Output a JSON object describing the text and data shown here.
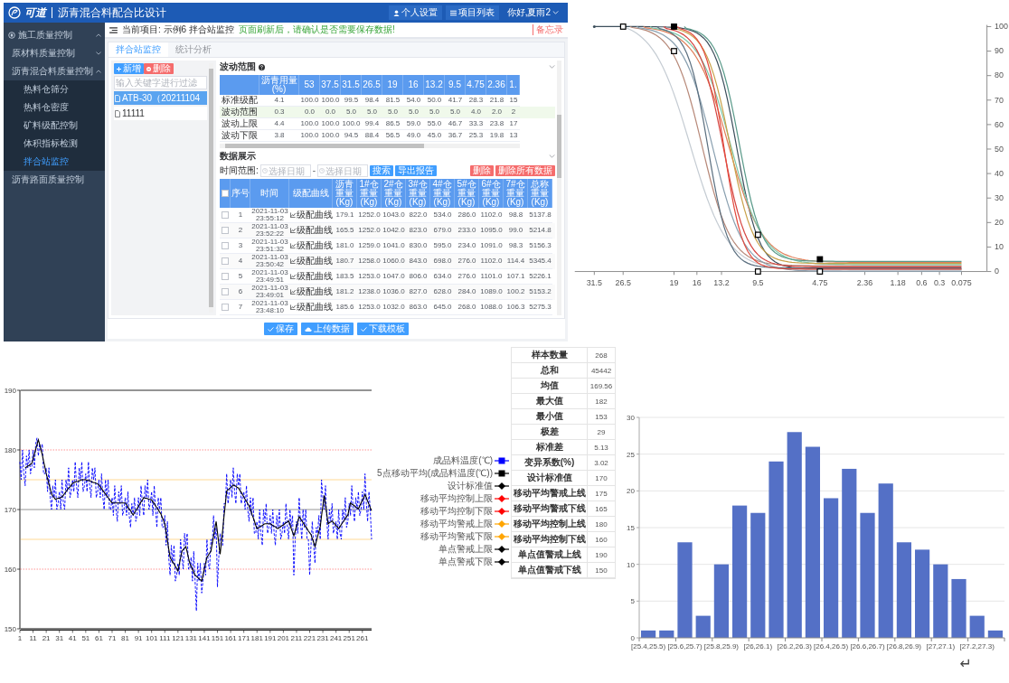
{
  "app": {
    "header": {
      "logo": "可道",
      "title": "沥青混合料配合比设计",
      "links": [
        {
          "label": "个人设置",
          "kind": "user"
        },
        {
          "label": "项目列表",
          "kind": "list"
        }
      ],
      "user_menu": "你好,夏雨2"
    },
    "sidebar": {
      "items": [
        {
          "label": "施工质量控制",
          "expanded": true,
          "children": [
            {
              "label": "原材料质量控制",
              "expanded": false
            },
            {
              "label": "沥青混合料质量控制",
              "expanded": true,
              "children": [
                {
                  "label": "热料仓筛分",
                  "selected": false
                },
                {
                  "label": "热料仓密度",
                  "selected": false
                },
                {
                  "label": "矿料级配控制",
                  "selected": false
                },
                {
                  "label": "体积指标检测",
                  "selected": false
                },
                {
                  "label": "拌合站监控",
                  "selected": true
                }
              ]
            },
            {
              "label": "沥青路面质量控制",
              "selected": false
            }
          ]
        }
      ]
    },
    "toolbar": {
      "breadcrumb": "当前项目: 示例6 拌合站监控",
      "notice": "页面刷新后，请确认是否需要保存数据!",
      "memo": "备忘录"
    },
    "tabs": [
      {
        "label": "拌合站监控",
        "selected": true
      },
      {
        "label": "统计分析",
        "selected": false
      }
    ],
    "record_list": {
      "buttons": [
        {
          "label": "新增",
          "kind": "add"
        },
        {
          "label": "删除",
          "kind": "delete"
        }
      ],
      "filter": {
        "placeholder": "输入关键字进行过滤"
      },
      "items": [
        {
          "label": "ATB-30（20211104",
          "selected": true
        },
        {
          "label": "11111",
          "selected": false
        }
      ]
    },
    "range_section": {
      "title": "波动范围",
      "columns": [
        "沥青用量(%)",
        "53",
        "37.5",
        "31.5",
        "26.5",
        "19",
        "16",
        "13.2",
        "9.5",
        "4.75",
        "2.36",
        "1."
      ],
      "rows": [
        {
          "label": "标准级配",
          "highlighted": false,
          "cells": [
            "4.1",
            "100.0",
            "100.0",
            "99.5",
            "98.4",
            "81.5",
            "54.0",
            "50.0",
            "41.7",
            "28.3",
            "21.8",
            "15"
          ]
        },
        {
          "label": "波动范围",
          "highlighted": true,
          "cells": [
            "0.3",
            "0.0",
            "0.0",
            "5.0",
            "5.0",
            "5.0",
            "5.0",
            "5.0",
            "5.0",
            "4.0",
            "2.0",
            "2"
          ]
        },
        {
          "label": "波动上限",
          "highlighted": false,
          "cells": [
            "4.4",
            "100.0",
            "100.0",
            "100.0",
            "99.4",
            "86.5",
            "59.0",
            "55.0",
            "46.7",
            "33.3",
            "23.8",
            "17"
          ]
        },
        {
          "label": "波动下限",
          "highlighted": false,
          "cells": [
            "3.8",
            "100.0",
            "100.0",
            "94.5",
            "88.4",
            "56.5",
            "49.0",
            "45.0",
            "36.7",
            "25.3",
            "19.8",
            "13"
          ]
        }
      ]
    },
    "data_section": {
      "title": "数据展示",
      "time_label": "时间范围:",
      "date_fields": [
        {
          "placeholder": "选择日期"
        },
        {
          "placeholder": "选择日期"
        }
      ],
      "separator": "-",
      "buttons": [
        {
          "label": "搜索",
          "kind": "search"
        },
        {
          "label": "导出报告",
          "kind": "export"
        },
        {
          "label": "删除",
          "kind": "delete"
        },
        {
          "label": "删除所有数据",
          "kind": "delete_all"
        }
      ],
      "table": {
        "header_checked": false,
        "columns": [
          "序号",
          "时间",
          "级配曲线",
          "沥青重量(Kg)",
          "1#仓重量(Kg)",
          "2#仓重量(Kg)",
          "3#仓重量(Kg)",
          "4#仓重量(Kg)",
          "5#仓重量(Kg)",
          "6#仓重量(Kg)",
          "7#仓重量(Kg)",
          "总称重量(Kg)"
        ],
        "rows": [
          {
            "checked": false,
            "index": "1",
            "time": "2021-11-03 23:55:12",
            "curve": "级配曲线",
            "weights": [
              "179.1",
              "1252.0",
              "1043.0",
              "822.0",
              "534.0",
              "286.0",
              "1102.0",
              "98.8",
              "5137.8"
            ]
          },
          {
            "checked": false,
            "index": "2",
            "time": "2021-11-03 23:52:22",
            "curve": "级配曲线",
            "weights": [
              "165.5",
              "1252.0",
              "1042.0",
              "823.0",
              "679.0",
              "233.0",
              "1095.0",
              "99.0",
              "5214.8"
            ]
          },
          {
            "checked": false,
            "index": "3",
            "time": "2021-11-03 23:51:32",
            "curve": "级配曲线",
            "weights": [
              "181.0",
              "1259.0",
              "1041.0",
              "830.0",
              "595.0",
              "234.0",
              "1091.0",
              "98.3",
              "5156.3"
            ]
          },
          {
            "checked": false,
            "index": "4",
            "time": "2021-11-03 23:50:42",
            "curve": "级配曲线",
            "weights": [
              "180.7",
              "1258.0",
              "1060.0",
              "843.0",
              "698.0",
              "276.0",
              "1102.0",
              "114.4",
              "5345.4"
            ]
          },
          {
            "checked": false,
            "index": "5",
            "time": "2021-11-03 23:49:51",
            "curve": "级配曲线",
            "weights": [
              "183.5",
              "1253.0",
              "1047.0",
              "806.0",
              "634.0",
              "276.0",
              "1101.0",
              "107.1",
              "5226.1"
            ]
          },
          {
            "checked": false,
            "index": "6",
            "time": "2021-11-03 23:49:01",
            "curve": "级配曲线",
            "weights": [
              "181.2",
              "1238.0",
              "1036.0",
              "827.0",
              "628.0",
              "284.0",
              "1089.0",
              "100.2",
              "5153.2"
            ]
          },
          {
            "checked": false,
            "index": "7",
            "time": "2021-11-03 23:48:10",
            "curve": "级配曲线",
            "weights": [
              "185.6",
              "1253.0",
              "1032.0",
              "863.0",
              "645.0",
              "268.0",
              "1088.0",
              "106.3",
              "5275.3"
            ]
          }
        ]
      }
    },
    "footer_buttons": [
      {
        "label": "保存",
        "kind": "save"
      },
      {
        "label": "上传数据",
        "kind": "upload"
      },
      {
        "label": "下载模板",
        "kind": "download"
      }
    ]
  },
  "grading_chart": {
    "x_labels": [
      "31.5",
      "26.5",
      "19",
      "16",
      "13.2",
      "9.5",
      "4.75",
      "2.36",
      "1.18",
      "0.6",
      "0.3",
      "0.075"
    ],
    "y_labels": [
      "100",
      "90",
      "80",
      "70",
      "60",
      "50",
      "40",
      "30",
      "20",
      "10",
      "0"
    ]
  },
  "control_chart": {
    "chart_data": {
      "type": "line",
      "xlim": [
        1,
        268
      ],
      "ylim": [
        150,
        190
      ],
      "xticks": [
        1,
        11,
        21,
        31,
        41,
        51,
        61,
        71,
        81,
        91,
        101,
        111,
        121,
        131,
        141,
        151,
        161,
        171,
        181,
        191,
        201,
        211,
        221,
        231,
        241,
        251,
        261
      ],
      "yticks": [
        150,
        160,
        170,
        180,
        190
      ],
      "x": [
        1,
        2,
        3,
        4,
        5,
        6,
        7,
        8,
        9,
        10,
        11,
        12,
        13,
        14,
        15,
        16,
        17,
        18,
        19,
        20,
        21,
        22,
        23,
        24,
        25,
        26,
        27,
        28,
        29,
        30,
        31,
        32,
        33,
        34,
        35,
        36,
        37,
        38,
        39,
        40,
        41,
        42,
        43,
        44,
        45,
        46,
        47,
        48,
        49,
        50,
        51,
        52,
        53,
        54,
        55,
        56,
        57,
        58,
        59,
        60,
        61,
        62,
        63,
        64,
        65,
        66,
        67,
        68,
        69,
        70,
        71,
        72,
        73,
        74,
        75,
        76,
        77,
        78,
        79,
        80,
        81,
        82,
        83,
        84,
        85,
        86,
        87,
        88,
        89,
        90,
        91,
        92,
        93,
        94,
        95,
        96,
        97,
        98,
        99,
        100,
        101,
        102,
        103,
        104,
        105,
        106,
        107,
        108,
        109,
        110,
        111,
        112,
        113,
        114,
        115,
        116,
        117,
        118,
        119,
        120,
        121,
        122,
        123,
        124,
        125,
        126,
        127,
        128,
        129,
        130,
        131,
        132,
        133,
        134,
        135,
        136,
        137,
        138,
        139,
        140,
        141,
        142,
        143,
        144,
        145,
        146,
        147,
        148,
        149,
        150,
        151,
        152,
        153,
        154,
        155,
        156,
        157,
        158,
        159,
        160,
        161,
        162,
        163,
        164,
        165,
        166,
        167,
        168,
        169,
        170,
        171,
        172,
        173,
        174,
        175,
        176,
        177,
        178,
        179,
        180,
        181,
        182,
        183,
        184,
        185,
        186,
        187,
        188,
        189,
        190,
        191,
        192,
        193,
        194,
        195,
        196,
        197,
        198,
        199,
        200,
        201,
        202,
        203,
        204,
        205,
        206,
        207,
        208,
        209,
        210,
        211,
        212,
        213,
        214,
        215,
        216,
        217,
        218,
        219,
        220,
        221,
        222,
        223,
        224,
        225,
        226,
        227,
        228,
        229,
        230,
        231,
        232,
        233,
        234,
        235,
        236,
        237,
        238,
        239,
        240,
        241,
        242,
        243,
        244,
        245,
        246,
        247,
        248,
        249,
        250,
        251,
        252,
        253,
        254,
        255,
        256,
        257,
        258,
        259,
        260,
        261,
        262,
        263,
        264,
        265,
        266,
        267,
        268
      ],
      "series": [
        {
          "name": "成品料温度(℃)",
          "color": "#0000ff",
          "line_style": "dashed",
          "values": [
            178,
            175,
            180,
            176,
            174,
            179,
            177,
            180,
            176,
            177,
            180,
            177,
            181,
            182,
            179,
            181,
            180,
            181,
            176,
            176,
            177,
            173,
            177,
            172,
            170,
            174,
            172,
            175,
            170,
            171,
            173,
            170,
            175,
            171,
            170,
            175,
            173,
            177,
            172,
            173,
            175,
            173,
            178,
            174,
            172,
            177,
            175,
            178,
            173,
            174,
            176,
            173,
            178,
            174,
            172,
            177,
            175,
            177,
            172,
            173,
            175,
            172,
            176,
            172,
            170,
            175,
            172,
            175,
            170,
            170,
            172,
            169,
            174,
            170,
            168,
            173,
            171,
            174,
            169,
            170,
            172,
            169,
            173,
            169,
            167,
            171,
            169,
            172,
            168,
            169,
            172,
            169,
            174,
            171,
            169,
            174,
            172,
            175,
            170,
            171,
            173,
            169,
            174,
            170,
            167,
            172,
            170,
            172,
            167,
            167,
            169,
            164,
            168,
            162,
            159,
            164,
            161,
            164,
            158,
            159,
            161,
            159,
            165,
            162,
            160,
            166,
            164,
            166,
            160,
            160,
            162,
            158,
            163,
            158,
            153,
            161,
            158,
            161,
            156,
            158,
            161,
            159,
            165,
            161,
            160,
            165,
            164,
            169,
            165,
            167,
            157,
            162,
            166,
            164,
            164,
            171,
            171,
            176,
            171,
            173,
            175,
            172,
            177,
            173,
            171,
            176,
            174,
            176,
            171,
            172,
            173,
            170,
            174,
            170,
            168,
            172,
            169,
            172,
            166,
            166,
            168,
            165,
            170,
            166,
            164,
            170,
            168,
            171,
            166,
            167,
            169,
            166,
            170,
            166,
            164,
            169,
            167,
            170,
            165,
            166,
            168,
            166,
            171,
            167,
            165,
            170,
            167,
            169,
            159,
            165,
            168,
            166,
            172,
            168,
            165,
            170,
            167,
            170,
            165,
            165,
            159,
            164,
            168,
            164,
            161,
            167,
            166,
            169,
            165,
            175,
            172,
            170,
            174,
            168,
            165,
            170,
            168,
            171,
            166,
            167,
            168,
            165,
            170,
            166,
            165,
            170,
            168,
            172,
            167,
            168,
            171,
            169,
            174,
            170,
            168,
            172,
            170,
            173,
            169,
            170,
            173,
            170,
            176,
            171,
            168,
            173,
            170,
            165
          ]
        },
        {
          "name": "5点移动平均(成品料温度(℃))",
          "color": "#000000",
          "values": [
            null,
            null,
            null,
            null,
            177,
            177.1,
            177.3,
            177.4,
            177.6,
            177.7,
            178.5,
            179.3,
            180.1,
            180.9,
            181.7,
            180.9,
            180,
            179.2,
            178.1,
            177.1,
            176,
            175.2,
            174.3,
            173.5,
            172.6,
            172.3,
            172,
            171.7,
            171.8,
            171.9,
            171.9,
            172,
            172.1,
            172.4,
            172.7,
            173,
            173.3,
            173.6,
            173.8,
            174.1,
            174.4,
            174.5,
            174.6,
            174.7,
            174.7,
            174.8,
            174.9,
            175,
            175,
            175,
            175,
            174.9,
            174.9,
            174.8,
            174.7,
            174.6,
            174.5,
            174.5,
            174.4,
            174.3,
            174.1,
            173.8,
            173.5,
            173.2,
            172.9,
            172.6,
            172.3,
            172,
            171.7,
            171.4,
            171.1,
            171.1,
            171.1,
            171.1,
            171.1,
            171.1,
            171.1,
            171.1,
            171.1,
            171.1,
            171.1,
            170.8,
            170.4,
            170.1,
            169.8,
            169.4,
            169.1,
            169.5,
            169.8,
            170.2,
            170.5,
            170.9,
            171.3,
            171.6,
            172,
            171.9,
            171.9,
            171.8,
            171.7,
            171.7,
            171.6,
            171.3,
            171,
            170.6,
            170.3,
            170,
            169.6,
            169.3,
            168.7,
            168.2,
            167.6,
            166.2,
            164.8,
            163.4,
            162,
            161.6,
            161.2,
            160.9,
            160.5,
            160.1,
            159.7,
            160.8,
            161.9,
            163,
            163.3,
            163.5,
            163.8,
            162.9,
            161.9,
            161,
            160.5,
            160,
            159.5,
            159,
            158.8,
            158.6,
            158.4,
            158.2,
            158,
            159,
            160,
            161,
            162,
            162.3,
            162.7,
            163,
            164.3,
            165.5,
            166.8,
            168,
            166.2,
            164.3,
            162.5,
            164.6,
            166.7,
            168.9,
            171,
            173.1,
            173.3,
            173.5,
            173.7,
            173.9,
            174.1,
            174,
            173.9,
            173.7,
            173.6,
            173.2,
            172.9,
            172.5,
            172.1,
            171.7,
            171.4,
            171,
            170.6,
            170,
            169.3,
            168.7,
            168.1,
            167.4,
            166.8,
            166.9,
            167.1,
            167.2,
            167.3,
            167.5,
            167.6,
            167.6,
            167.6,
            167.6,
            167.6,
            167.5,
            167.3,
            167.2,
            167.1,
            166.9,
            166.8,
            167,
            167.1,
            167.3,
            167.4,
            167.6,
            167.8,
            167.9,
            168.1,
            167.5,
            166.8,
            166.2,
            165.6,
            166.4,
            167.2,
            168,
            168.8,
            168.5,
            168.1,
            167.8,
            167.4,
            167.1,
            166.8,
            166.4,
            166.1,
            165.8,
            165.1,
            164.5,
            163.8,
            164.6,
            165.5,
            166.3,
            167.1,
            168.9,
            170.6,
            172.4,
            170.8,
            169.2,
            167.6,
            167.8,
            167.9,
            168.1,
            167.8,
            167.6,
            167.3,
            167.1,
            166.8,
            167.1,
            167.5,
            167.8,
            168.1,
            168.5,
            168.8,
            169.1,
            170.1,
            171.1,
            170.9,
            170.8,
            170.6,
            170.4,
            170.3,
            170.1,
            170.6,
            171.1,
            171.5,
            172,
            172.5,
            172,
            171.4,
            170.9,
            170.3,
            169.8
          ]
        }
      ],
      "ref_lines": [
        {
          "axis": "y",
          "value": 170,
          "label": "设计标准值",
          "color": "#000000"
        },
        {
          "axis": "y",
          "value": 180,
          "label": "移动平均控制上限",
          "color": "#ff0000",
          "line_style": "dotted"
        },
        {
          "axis": "y",
          "value": 160,
          "label": "移动平均控制下限",
          "color": "#ff0000",
          "line_style": "dotted"
        },
        {
          "axis": "y",
          "value": 175,
          "label": "移动平均警戒上限",
          "color": "#ffa500"
        },
        {
          "axis": "y",
          "value": 165,
          "label": "移动平均警戒下限",
          "color": "#ffa500"
        },
        {
          "axis": "y",
          "value": 190,
          "label": "单点警戒上限",
          "color": "#000000"
        },
        {
          "axis": "y",
          "value": 150,
          "label": "单点警戒下限",
          "color": "#000000"
        }
      ]
    }
  },
  "stats_table": [
    {
      "label": "样本数量",
      "value": "268"
    },
    {
      "label": "总和",
      "value": "45442"
    },
    {
      "label": "均值",
      "value": "169.56"
    },
    {
      "label": "最大值",
      "value": "182"
    },
    {
      "label": "最小值",
      "value": "153"
    },
    {
      "label": "极差",
      "value": "29"
    },
    {
      "label": "标准差",
      "value": "5.13"
    },
    {
      "label": "变异系数(%)",
      "value": "3.02"
    },
    {
      "label": "设计标准值",
      "value": "170"
    },
    {
      "label": "移动平均警戒上线",
      "value": "175"
    },
    {
      "label": "移动平均警戒下线",
      "value": "165"
    },
    {
      "label": "移动平均控制上线",
      "value": "180"
    },
    {
      "label": "移动平均控制下线",
      "value": "160"
    },
    {
      "label": "单点值警戒上线",
      "value": "190"
    },
    {
      "label": "单点值警戒下线",
      "value": "150"
    }
  ],
  "histogram": {
    "chart_data": {
      "type": "bar",
      "grid": true,
      "categories": [
        "[25.4,25.5)",
        null,
        "[25.6,25.7)",
        null,
        "[25.8,25.9)",
        null,
        "[26,26.1)",
        null,
        "[26.2,26.3)",
        null,
        "[26.4,26.5)",
        null,
        "[26.6,26.7)",
        null,
        "[26.8,26.9)",
        null,
        "[27,27.1)",
        null,
        "[27.2,27.3)",
        null
      ],
      "values": [
        1,
        1,
        13,
        3,
        10,
        18,
        17,
        24,
        28,
        26,
        19,
        23,
        17,
        21,
        13,
        12,
        10,
        8,
        3,
        1
      ],
      "yticks": [
        0,
        5,
        10,
        15,
        20,
        25,
        30
      ],
      "ylim": [
        0,
        30
      ]
    }
  },
  "paragraph_mark": "↵"
}
